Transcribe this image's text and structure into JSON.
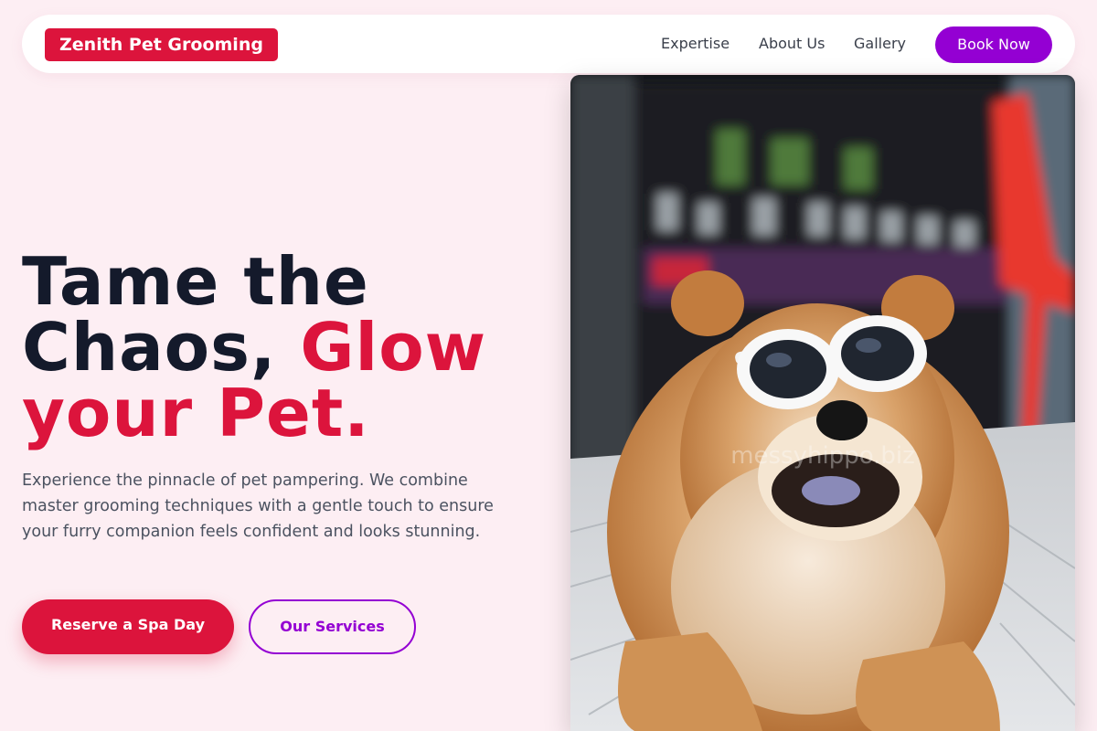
{
  "brand": {
    "name": "Zenith Pet Grooming",
    "color": "#dc143c"
  },
  "nav": {
    "links": [
      "Expertise",
      "About Us",
      "Gallery"
    ],
    "cta": "Book Now",
    "cta_color": "#9400d3"
  },
  "hero": {
    "headline_line1": "Tame the",
    "headline_line2a": "Chaos, ",
    "headline_line2b": "Glow",
    "headline_line3": "your Pet.",
    "description": "Experience the pinnacle of pet pampering. We combine master grooming techniques with a gentle touch to ensure your furry companion feels confident and looks stunning.",
    "primary_button": "Reserve a Spa Day",
    "secondary_button": "Our Services"
  },
  "image": {
    "subject": "chow-chow-dog-with-white-sunglasses",
    "watermark": "messyhippo.biz"
  },
  "colors": {
    "background": "#fdeef3",
    "headline": "#141a2b",
    "accent": "#dc143c",
    "secondary_accent": "#9400d3"
  }
}
